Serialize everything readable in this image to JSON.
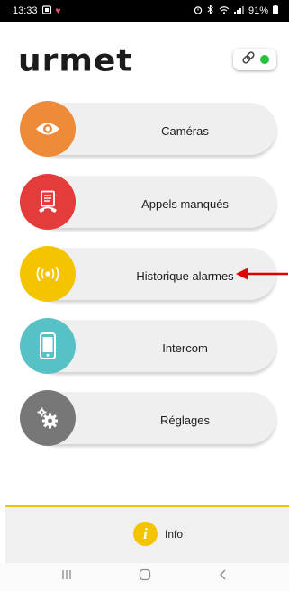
{
  "status_bar": {
    "time": "13:33",
    "battery": "91%"
  },
  "header": {
    "logo_text": "urmet"
  },
  "menu": [
    {
      "label": "Caméras",
      "icon": "eye-icon",
      "color": "#ef8a38"
    },
    {
      "label": "Appels manqués",
      "icon": "missed-call-icon",
      "color": "#e43b3b"
    },
    {
      "label": "Historique alarmes",
      "icon": "alarm-signal-icon",
      "color": "#f4c400"
    },
    {
      "label": "Intercom",
      "icon": "smartphone-icon",
      "color": "#58c1c5"
    },
    {
      "label": "Réglages",
      "icon": "gears-icon",
      "color": "#777777"
    }
  ],
  "footer": {
    "info_label": "Info",
    "accent_color": "#f1c200"
  },
  "annotation": {
    "arrow_color": "#e00000"
  }
}
